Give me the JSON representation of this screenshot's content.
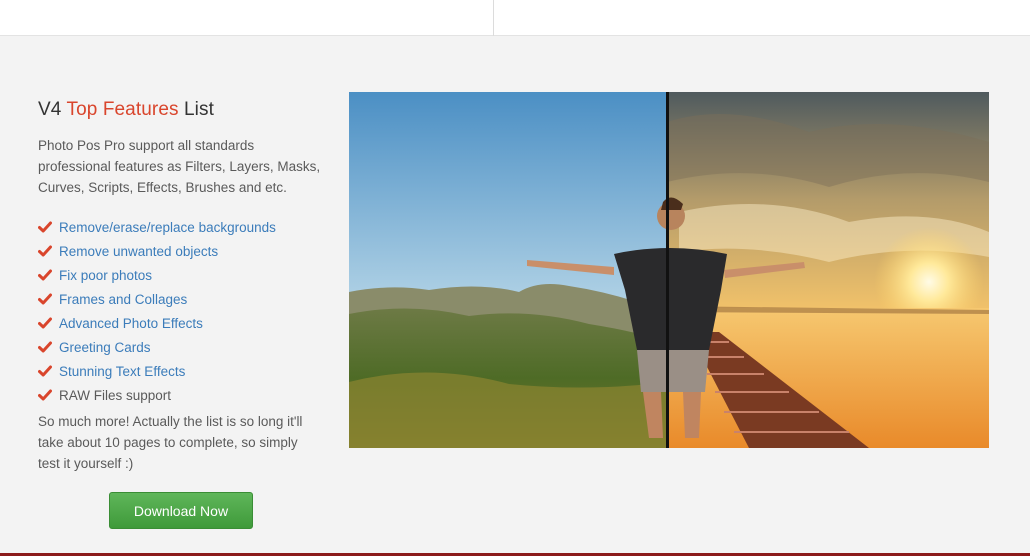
{
  "section": {
    "title_prefix": "V4",
    "title_accent": "Top Features",
    "title_suffix": "List",
    "intro": "Photo Pos Pro support all standards professional features as Filters, Layers, Masks, Curves, Scripts, Effects, Brushes and etc.",
    "features": [
      {
        "label": "Remove/erase/replace backgrounds",
        "link": true
      },
      {
        "label": "Remove unwanted objects",
        "link": true
      },
      {
        "label": "Fix poor photos",
        "link": true
      },
      {
        "label": "Frames and Collages",
        "link": true
      },
      {
        "label": "Advanced Photo Effects",
        "link": true
      },
      {
        "label": "Greeting Cards",
        "link": true
      },
      {
        "label": "Stunning Text Effects",
        "link": true
      },
      {
        "label": "RAW Files support",
        "link": false
      }
    ],
    "outro": "So much more! Actually the list is so long it'll take about 10 pages to complete, so simply test it yourself :)",
    "download_label": "Download Now"
  },
  "colors": {
    "accent": "#d9452c",
    "link": "#3b7cba",
    "check": "#d9452c",
    "button": "#4aa545"
  },
  "hero": {
    "icon": "before-after-photo"
  }
}
